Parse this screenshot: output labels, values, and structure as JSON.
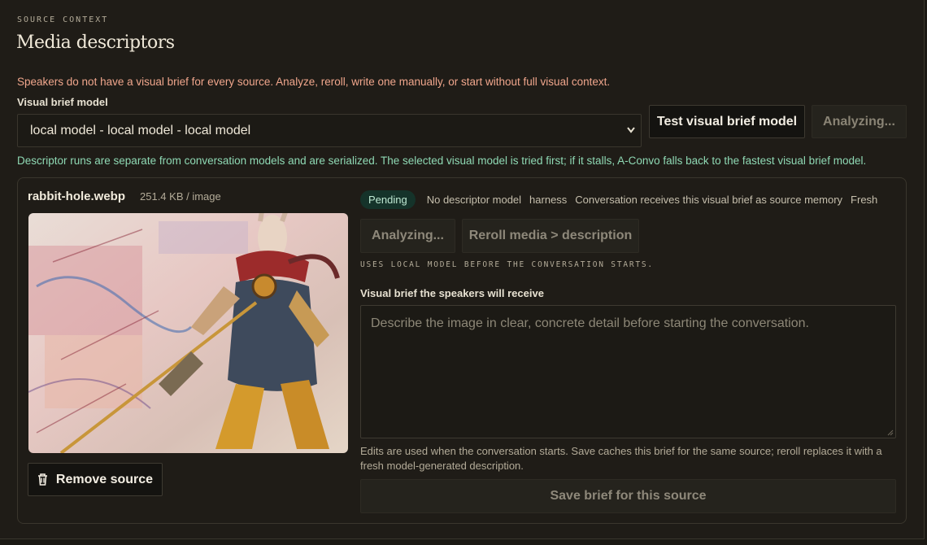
{
  "header": {
    "eyebrow": "SOURCE CONTEXT",
    "title": "Media descriptors"
  },
  "warning": "Speakers do not have a visual brief for every source. Analyze, reroll, write one manually, or start without full visual context.",
  "model": {
    "label": "Visual brief model",
    "selected": "local model - local model - local model",
    "test_button": "Test visual brief model",
    "analyzing_button": "Analyzing..."
  },
  "info": "Descriptor runs are separate from conversation models and are serialized. The selected visual model is tried first; if it stalls, A-Convo falls back to the fastest visual brief model.",
  "source": {
    "filename": "rabbit-hole.webp",
    "filesize": "251.4 KB / image",
    "remove_button": "Remove source",
    "status": {
      "badge": "Pending",
      "model": "No descriptor model",
      "harness": "harness",
      "memory": "Conversation receives this visual brief as source memory",
      "freshness": "Fresh"
    },
    "analyzing_button": "Analyzing...",
    "reroll_button": "Reroll media > description",
    "local_note": "USES LOCAL MODEL BEFORE THE CONVERSATION STARTS.",
    "brief_label": "Visual brief the speakers will receive",
    "brief_placeholder": "Describe the image in clear, concrete detail before starting the conversation.",
    "edits_note": "Edits are used when the conversation starts. Save caches this brief for the same source; reroll replaces it with a fresh model-generated description.",
    "save_button": "Save brief for this source"
  },
  "colors": {
    "background": "#1f1c17",
    "warning": "#f0a68c",
    "info": "#8fd9b4",
    "pending_badge": "#15332a"
  }
}
